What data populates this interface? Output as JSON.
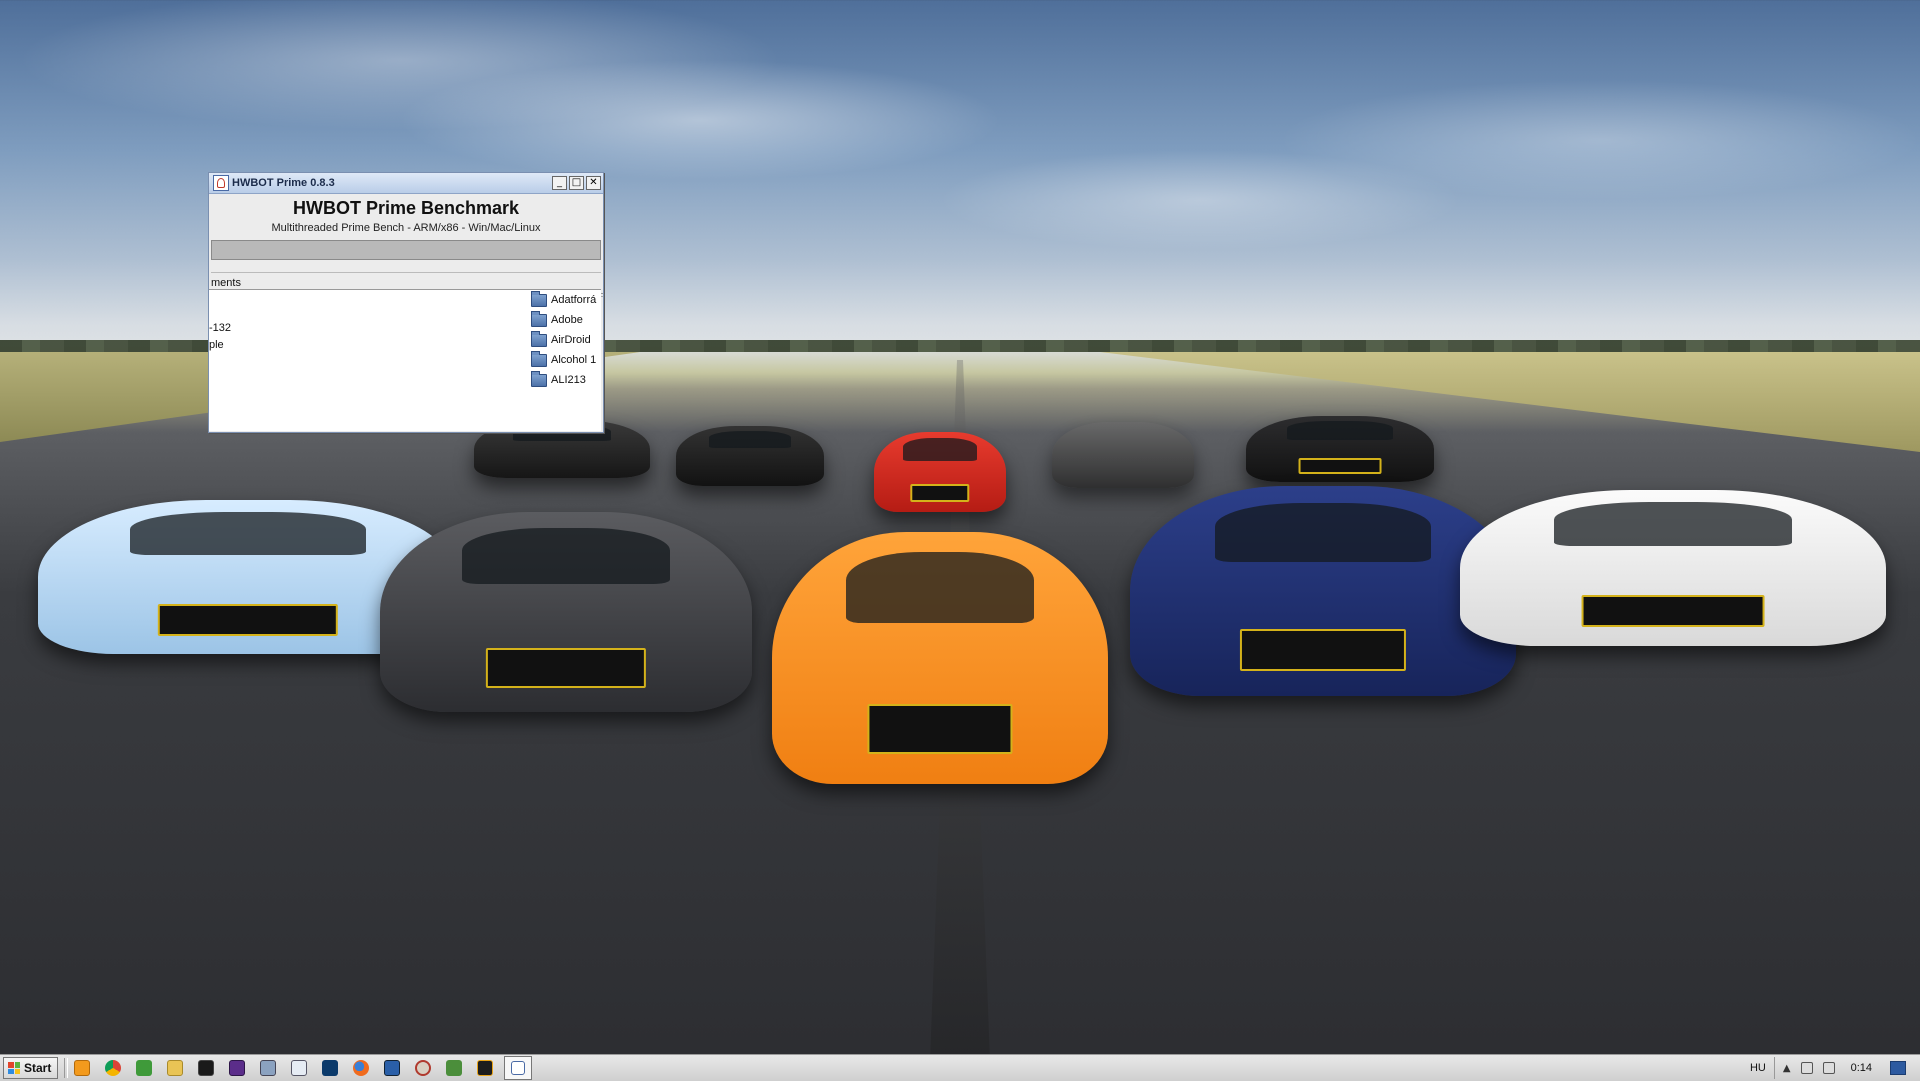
{
  "window": {
    "title": "HWBOT Prime 0.8.3",
    "buttons": {
      "minimize": "_",
      "maximize": "□",
      "close": "✕"
    },
    "app_title": "HWBOT Prime Benchmark",
    "subtitle": "Multithreaded Prime Bench - ARM/x86 - Win/Mac/Linux",
    "progress": 0,
    "tab_label": "ments",
    "left_list": [
      "",
      "-132",
      "ple"
    ],
    "folders": [
      "Adatforrá",
      "Adobe",
      "AirDroid",
      "Alcohol 1",
      "ALI213"
    ]
  },
  "taskbar": {
    "start_label": "Start",
    "icons": [
      "media-player-icon",
      "chrome-icon",
      "media-icon",
      "file-manager-icon",
      "tool-icon",
      "app-icon",
      "camera-icon",
      "window-icon",
      "app-arrow-icon",
      "firefox-icon",
      "monitor-icon",
      "settings-icon",
      "map-icon",
      "winamp-icon"
    ],
    "active_app_icon": "hwbot-icon",
    "language": "HU",
    "clock": "0:14"
  }
}
